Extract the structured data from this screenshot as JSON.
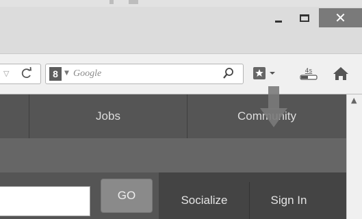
{
  "window": {
    "minimize_icon": "minimize-icon",
    "maximize_icon": "maximize-icon",
    "close_glyph": "✕"
  },
  "toolbar": {
    "reload_glyph": "C",
    "url_dropdown_glyph": "▽",
    "search": {
      "engine_letter": "8",
      "placeholder": "Google"
    },
    "icons": [
      "search-icon",
      "bookmarks-menu-icon",
      "downloads-icon",
      "home-icon"
    ],
    "downloads_badge": "4s"
  },
  "page": {
    "nav": [
      "Jobs",
      "Community"
    ],
    "search_button": "GO",
    "header_links": [
      "Socialize",
      "Sign In"
    ]
  },
  "colors": {
    "window_close": "#7a7a7a",
    "page_nav": "#555555",
    "page_header": "#444444"
  }
}
